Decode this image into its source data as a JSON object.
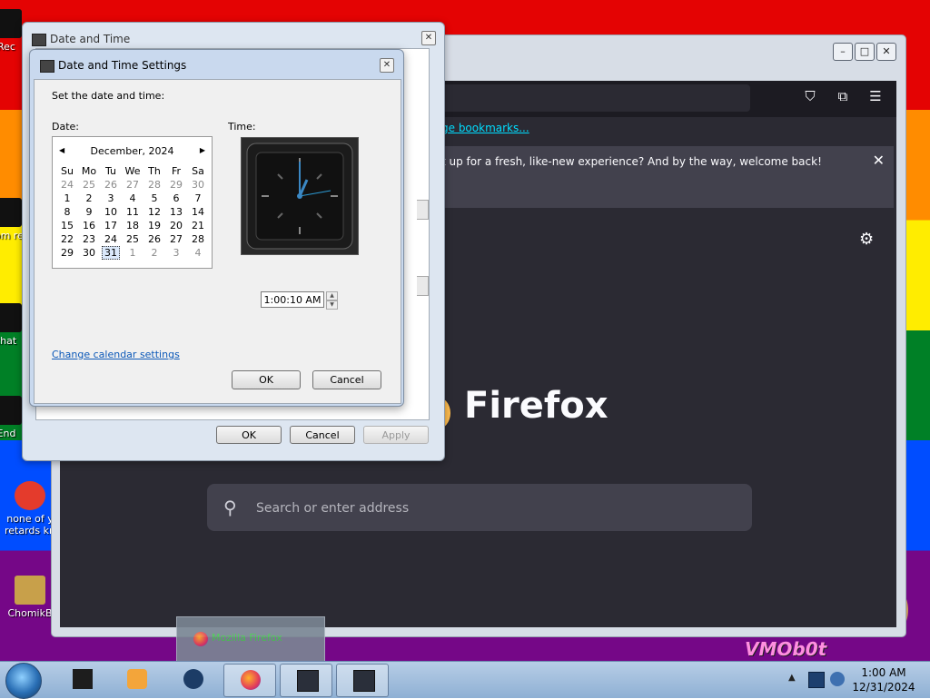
{
  "desktop": {
    "icons": [
      {
        "label": "Rec"
      },
      {
        "label": "som re"
      },
      {
        "label": "that"
      },
      {
        "label": "End"
      },
      {
        "label": "none of y retards kn"
      },
      {
        "label": "ChomikB"
      }
    ],
    "watermark": "VMOb0t"
  },
  "firefox": {
    "bookmarks_text": "ge bookmarks...",
    "notice_text": "t up for a fresh, like-new experience? And by the way, welcome back!",
    "logo_text": "Firefox",
    "search_placeholder": "Search or enter address",
    "taskbar_preview_label": "Mozilla Firefox",
    "colors": {
      "background": "#2b2a33",
      "link": "#00ddff"
    }
  },
  "date_time_dialog": {
    "title": "Date and Time",
    "buttons": {
      "ok": "OK",
      "cancel": "Cancel",
      "apply": "Apply"
    }
  },
  "date_time_settings": {
    "title": "Date and Time Settings",
    "heading": "Set the date and time:",
    "date_label": "Date:",
    "time_label": "Time:",
    "calendar": {
      "month": "December, 2024",
      "weekdays": [
        "Su",
        "Mo",
        "Tu",
        "We",
        "Th",
        "Fr",
        "Sa"
      ],
      "weeks": [
        [
          "24",
          "25",
          "26",
          "27",
          "28",
          "29",
          "30"
        ],
        [
          "1",
          "2",
          "3",
          "4",
          "5",
          "6",
          "7"
        ],
        [
          "8",
          "9",
          "10",
          "11",
          "12",
          "13",
          "14"
        ],
        [
          "15",
          "16",
          "17",
          "18",
          "19",
          "20",
          "21"
        ],
        [
          "22",
          "23",
          "24",
          "25",
          "26",
          "27",
          "28"
        ],
        [
          "29",
          "30",
          "31",
          "1",
          "2",
          "3",
          "4"
        ]
      ],
      "selected": "31"
    },
    "time_value": "1:00:10 AM",
    "change_calendar_link": "Change calendar settings",
    "buttons": {
      "ok": "OK",
      "cancel": "Cancel"
    }
  },
  "taskbar": {
    "clock_time": "1:00 AM",
    "clock_date": "12/31/2024"
  }
}
